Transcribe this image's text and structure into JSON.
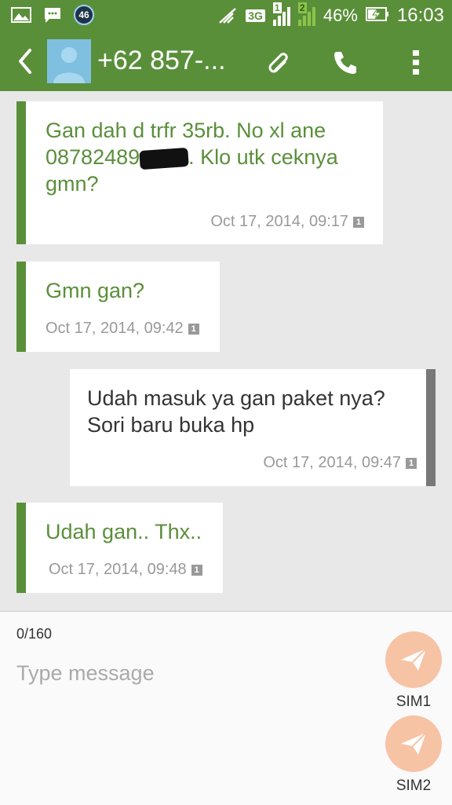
{
  "status_bar": {
    "notification_count": "46",
    "network": "3G",
    "sim1_label": "1",
    "sim2_label": "2",
    "battery": "46%",
    "time": "16:03"
  },
  "app_bar": {
    "contact": "+62 857-..."
  },
  "messages": [
    {
      "direction": "in",
      "text_before": "Gan dah d trfr 35rb. No xl ane 08782489",
      "text_after": ". Klo utk ceknya gmn?",
      "time": "Oct 17, 2014, 09:17",
      "sim": "1"
    },
    {
      "direction": "in",
      "text": "Gmn gan?",
      "time": "Oct 17, 2014, 09:42",
      "sim": "1"
    },
    {
      "direction": "out",
      "text": "Udah masuk ya gan paket nya? Sori baru buka hp",
      "time": "Oct 17, 2014, 09:47",
      "sim": "1"
    },
    {
      "direction": "in",
      "text": "Udah gan.. Thx..",
      "time": "Oct 17, 2014, 09:48",
      "sim": "1"
    }
  ],
  "compose": {
    "counter": "0/160",
    "placeholder": "Type message",
    "sim1_label": "SIM1",
    "sim2_label": "SIM2"
  },
  "colors": {
    "accent": "#5a8f3a",
    "send_button": "#f7c3a5",
    "outgoing_border": "#787878"
  }
}
